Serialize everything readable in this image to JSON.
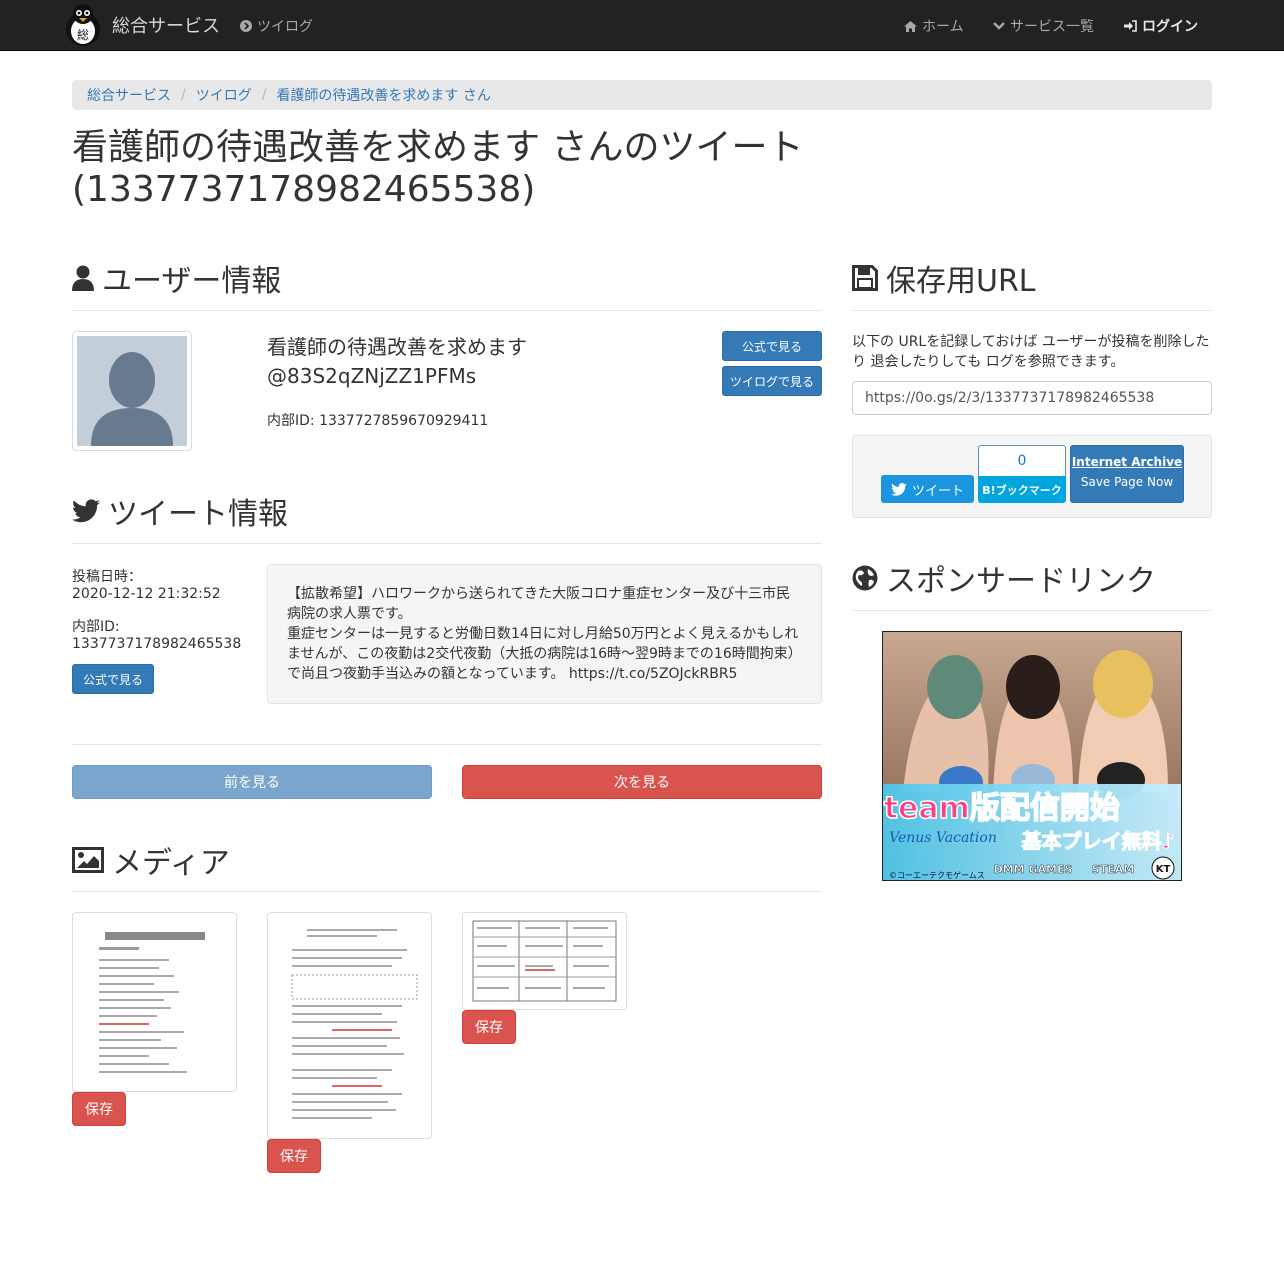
{
  "navbar": {
    "brand": "総合サービス",
    "logo_char": "総",
    "twilog": "ツイログ",
    "home": "ホーム",
    "services": "サービス一覧",
    "login": "ログイン"
  },
  "breadcrumb": [
    "総合サービス",
    "ツイログ",
    "看護師の待遇改善を求めます さん"
  ],
  "page_title": "看護師の待遇改善を求めます さんのツイート(1337737178982465538)",
  "user_section": {
    "heading": "ユーザー情報",
    "display_name": "看護師の待遇改善を求めます",
    "screen_name": "@83S2qZNjZZ1PFMs",
    "internal_id": "内部ID: 1337727859670929411",
    "btn_official": "公式で見る",
    "btn_twilog": "ツイログで見る"
  },
  "tweet_section": {
    "heading": "ツイート情報",
    "posted_label": "投稿日時：",
    "posted_value": "2020-12-12 21:32:52",
    "id_label": "内部ID:",
    "id_value": "1337737178982465538",
    "btn_official": "公式で見る",
    "text_lines": [
      "【拡散希望】ハロワークから送られてきた大阪コロナ重症センター及び十三市民",
      "病院の求人票です。",
      "重症センターは一見すると労働日数14日に対し月給50万円とよく見えるかもしれ",
      "ませんが、この夜勤は2交代夜勤（大抵の病院は16時～翌9時までの16時間拘束）",
      "で尚且つ夜勤手当込みの額となっています。 https://t.co/5ZOJckRBR5"
    ]
  },
  "pager": {
    "prev": "前を見る",
    "next": "次を見る"
  },
  "media_section": {
    "heading": "メディア",
    "save_label": "保存"
  },
  "save_url_section": {
    "heading": "保存用URL",
    "note": "以下の URLを記録しておけば ユーザーが投稿を削除したり 退会したりしても ログを参照できます。",
    "url": "https://0o.gs/2/3/1337737178982465538",
    "tweet_btn": "ツイート",
    "hatena_count": "0",
    "hatena_btn": "B!ブックマーク",
    "ia_title": "Internet Archive",
    "ia_sub": "Save Page Now"
  },
  "sponsor_section": {
    "heading": "スポンサードリンク",
    "ad_banner": "Steam版配信開始",
    "ad_sub": "基本プレイ無料♪",
    "ad_logos": [
      "DMM GAMES",
      "STEAM",
      "KT"
    ],
    "ad_copyright": "©コーエーテクモゲームス"
  },
  "colors": {
    "navbar": "#222222",
    "primary": "#337ab7",
    "danger": "#d9534f",
    "prev_disabled": "#7aa6cd"
  },
  "icons": [
    "home-icon",
    "chevron-down-icon",
    "sign-in-icon",
    "chevron-circle-right-icon",
    "user-icon",
    "twitter-icon",
    "image-icon",
    "floppy-disk-icon",
    "globe-icon"
  ]
}
